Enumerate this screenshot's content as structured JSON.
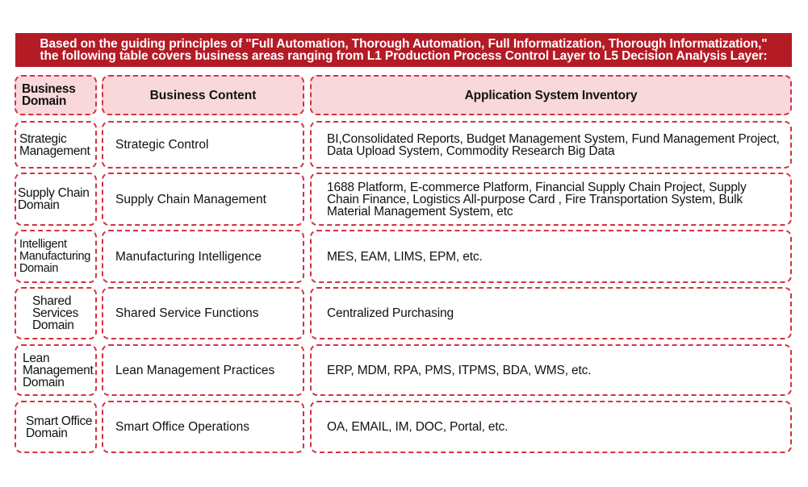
{
  "banner": {
    "line1": "Based on the guiding principles of \"Full Automation, Thorough Automation, Full Informatization, Thorough Informatization,\"",
    "line2": "the following table covers business areas ranging from L1 Production Process Control Layer to L5 Decision Analysis Layer:",
    "color": "#b31b25"
  },
  "table": {
    "headers": [
      "Business Domain",
      "Business Content",
      "Application System Inventory"
    ],
    "header_bg": "#f9d8dc",
    "border_color": "#d7303f",
    "rows": [
      {
        "domain": "Strategic Management",
        "content": "Strategic Control",
        "systems": "BI,Consolidated Reports, Budget Management System, Fund Management Project, Data Upload System, Commodity Research Big Data"
      },
      {
        "domain": "Supply Chain Domain",
        "content": "Supply Chain Management",
        "systems": "1688 Platform, E-commerce Platform, Financial Supply Chain Project, Supply Chain Finance, Logistics All-purpose Card , Fire Transportation System, Bulk Material Management System, etc"
      },
      {
        "domain": "Intelligent Manufacturing Domain",
        "content": "Manufacturing Intelligence",
        "systems": "MES, EAM, LIMS, EPM, etc."
      },
      {
        "domain": "Shared Services Domain",
        "content": "Shared Service Functions",
        "systems": "Centralized Purchasing"
      },
      {
        "domain": "Lean Management Domain",
        "content": "Lean Management Practices",
        "systems": "ERP, MDM, RPA, PMS, ITPMS, BDA, WMS, etc."
      },
      {
        "domain": "Smart Office Domain",
        "content": "Smart Office Operations",
        "systems": "OA, EMAIL, IM, DOC, Portal, etc."
      }
    ]
  }
}
